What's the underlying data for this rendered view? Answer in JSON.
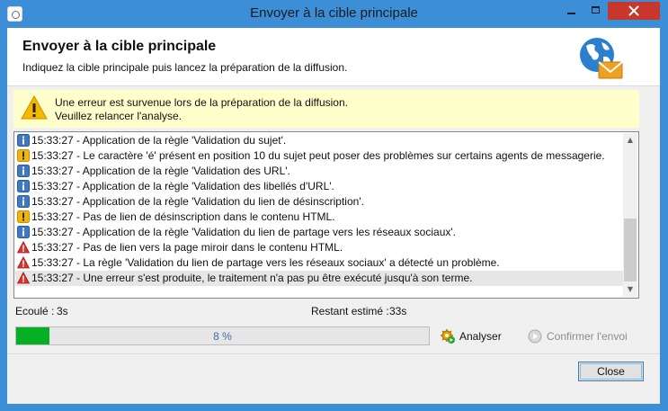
{
  "window": {
    "title": "Envoyer à la cible principale"
  },
  "header": {
    "title": "Envoyer à la cible principale",
    "subtitle": "Indiquez la cible principale puis lancez la préparation de la diffusion."
  },
  "warning": {
    "line1": "Une erreur est survenue lors de la préparation de la diffusion.",
    "line2": "Veuillez relancer l'analyse."
  },
  "log": {
    "entries": [
      {
        "type": "info",
        "text": "15:33:27 - Application de la règle 'Validation du sujet'."
      },
      {
        "type": "warning",
        "text": "15:33:27 - Le caractère 'é' présent en position 10 du sujet peut poser des problèmes sur certains agents de messagerie."
      },
      {
        "type": "info",
        "text": "15:33:27 - Application de la règle 'Validation des URL'."
      },
      {
        "type": "info",
        "text": "15:33:27 - Application de la règle 'Validation des libellés d'URL'."
      },
      {
        "type": "info",
        "text": "15:33:27 - Application de la règle 'Validation du lien de désinscription'."
      },
      {
        "type": "warning",
        "text": "15:33:27 - Pas de lien de désinscription dans le contenu HTML."
      },
      {
        "type": "info",
        "text": "15:33:27 - Application de la règle 'Validation du lien de partage vers les réseaux sociaux'."
      },
      {
        "type": "error",
        "text": "15:33:27 - Pas de lien vers la page miroir dans le contenu HTML."
      },
      {
        "type": "error",
        "text": "15:33:27 - La règle 'Validation du lien de partage vers les réseaux sociaux' a détecté un problème."
      },
      {
        "type": "error",
        "text": "15:33:27 - Une erreur s'est produite, le traitement n'a pas pu être exécuté jusqu'à son terme.",
        "selected": true
      }
    ]
  },
  "stats": {
    "elapsed_label": "Ecoulé :",
    "elapsed_value": "3s",
    "remaining_label": "Restant estimé :",
    "remaining_value": "33s"
  },
  "progress": {
    "value": 0.08,
    "label": "8 %"
  },
  "actions": {
    "analyze_label": "Analyser",
    "confirm_label": "Confirmer l'envoi"
  },
  "footer": {
    "close_label": "Close"
  },
  "colors": {
    "titlebar": "#3c8fd6",
    "warning_bg": "#ffffcc",
    "progress_fill": "#06b025",
    "close_red": "#c7372c"
  }
}
